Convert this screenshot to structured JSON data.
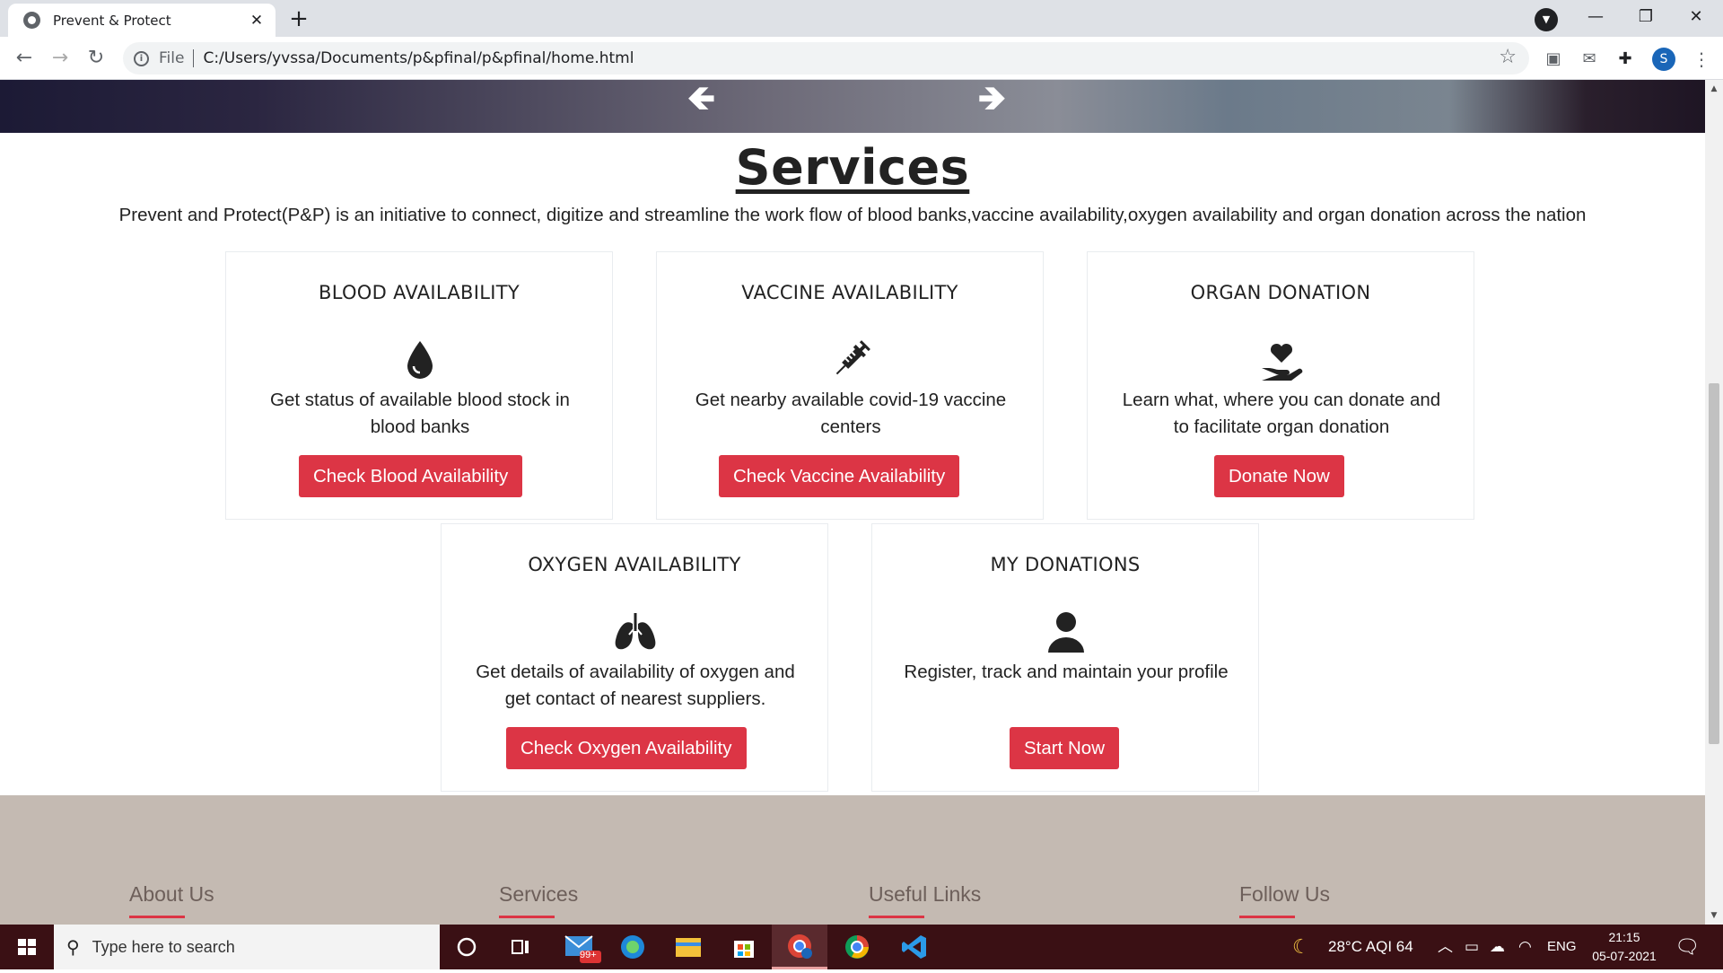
{
  "browser": {
    "tab_title": "Prevent & Protect",
    "scheme_label": "File",
    "url": "C:/Users/yvssa/Documents/p&pfinal/p&pfinal/home.html",
    "profile_initial": "S"
  },
  "hero": {
    "prev_arrow": "🡸",
    "next_arrow": "🡺"
  },
  "services": {
    "title": "Services",
    "description": "Prevent and Protect(P&P) is an initiative to connect, digitize and streamline the work flow of blood banks,vaccine availability,oxygen availability and organ donation across the nation",
    "cards": [
      {
        "title": "BLOOD AVAILABILITY",
        "icon": "blood-drop-icon",
        "text": "Get status of available blood stock in blood banks",
        "button": "Check Blood Availability"
      },
      {
        "title": "VACCINE AVAILABILITY",
        "icon": "syringe-icon",
        "text": "Get nearby available covid-19 vaccine centers",
        "button": "Check Vaccine Availability"
      },
      {
        "title": "ORGAN DONATION",
        "icon": "hand-heart-icon",
        "text": "Learn what, where you can donate and to facilitate organ donation",
        "button": "Donate Now"
      },
      {
        "title": "OXYGEN AVAILABILITY",
        "icon": "lungs-icon",
        "text": "Get details of availability of oxygen and get contact of nearest suppliers.",
        "button": "Check Oxygen Availability"
      },
      {
        "title": "MY DONATIONS",
        "icon": "user-icon",
        "text": "Register, track and maintain your profile",
        "button": "Start Now"
      }
    ]
  },
  "footer": {
    "headings": [
      "About Us",
      "Services",
      "Useful Links",
      "Follow Us"
    ]
  },
  "taskbar": {
    "search_placeholder": "Type here to search",
    "mail_badge": "99+",
    "weather": "28°C  AQI 64",
    "language": "ENG",
    "time": "21:15",
    "date": "05-07-2021"
  },
  "colors": {
    "accent": "#dc3545",
    "footer_bg": "#c4bab2",
    "taskbar_bg": "#3a1014"
  }
}
